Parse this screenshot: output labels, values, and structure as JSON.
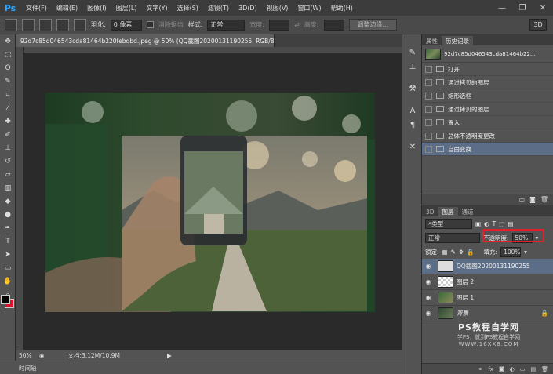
{
  "app": {
    "logo": "Ps",
    "menu": [
      "文件(F)",
      "编辑(E)",
      "图像(I)",
      "图层(L)",
      "文字(Y)",
      "选择(S)",
      "滤镜(T)",
      "3D(D)",
      "视图(V)",
      "窗口(W)",
      "帮助(H)"
    ]
  },
  "options": {
    "feather_label": "羽化:",
    "feather_value": "0 像素",
    "antialias_label": "消除锯齿",
    "style_label": "样式:",
    "style_value": "正常",
    "width_label": "宽度:",
    "height_label": "高度:",
    "refine_button": "调整边缘...",
    "threed_button": "3D"
  },
  "document": {
    "tab_title": "92d7c85d046543cda81464b220febdbd.jpeg @ 50% (QQ截图20200131190255, RGB/8#) *",
    "close": "×"
  },
  "status": {
    "zoom": "50%",
    "doc_info": "文档:3.12M/10.9M",
    "timeline": "时间轴"
  },
  "history": {
    "tabs": [
      "属性",
      "历史记录"
    ],
    "snapshot": "92d7c85d046543cda81464b22...",
    "items": [
      {
        "label": "打开",
        "selected": false
      },
      {
        "label": "通过拷贝的图层",
        "selected": false
      },
      {
        "label": "矩形选框",
        "selected": false
      },
      {
        "label": "通过拷贝的图层",
        "selected": false
      },
      {
        "label": "置入",
        "selected": false
      },
      {
        "label": "总体不透明度更改",
        "selected": false
      },
      {
        "label": "自由变换",
        "selected": true
      }
    ]
  },
  "layers": {
    "tabs": [
      "3D",
      "图层",
      "通道"
    ],
    "kind_label": "类型",
    "blend_mode": "正常",
    "opacity_label": "不透明度:",
    "opacity_value": "50%",
    "lock_label": "锁定:",
    "fill_label": "填充:",
    "fill_value": "100%",
    "items": [
      {
        "name": "QQ截图20200131190255",
        "selected": true
      },
      {
        "name": "图层 2",
        "selected": false
      },
      {
        "name": "图层 1",
        "selected": false
      },
      {
        "name": "背景",
        "selected": false
      }
    ]
  },
  "watermark": {
    "line1": "PS教程自学网",
    "line2": "学PS，就到PS教程自学网",
    "line3": "WWW.16XX8.COM"
  }
}
